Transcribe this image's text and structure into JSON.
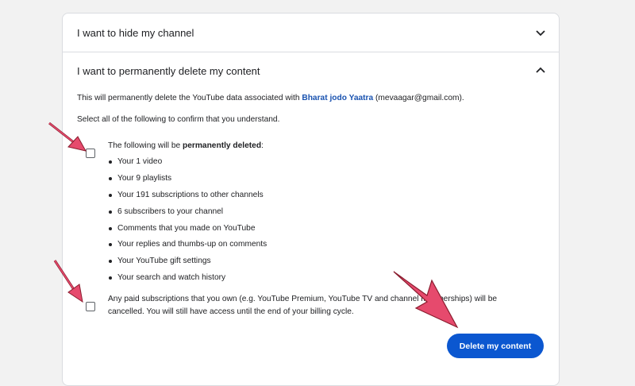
{
  "sections": [
    {
      "title": "I want to hide my channel",
      "state": "collapsed",
      "icon": "chevron-down-icon"
    },
    {
      "title": "I want to permanently delete my content",
      "state": "expanded",
      "icon": "chevron-up-icon"
    }
  ],
  "delete_section": {
    "info_prefix": "This will permanently delete the YouTube data associated with ",
    "channel_name": "Bharat jodo Yaatra",
    "info_suffix": " (mevaagar@gmail.com).",
    "confirm_instruction": "Select all of the following to confirm that you understand.",
    "checkbox1": {
      "checked": false,
      "label_prefix": "The following will be ",
      "label_bold": "permanently deleted",
      "label_suffix": ":"
    },
    "deleted_items": [
      "Your 1 video",
      "Your 9 playlists",
      "Your 191 subscriptions to other channels",
      "6 subscribers to your channel",
      "Comments that you made on YouTube",
      "Your replies and thumbs-up on comments",
      "Your YouTube gift settings",
      "Your search and watch history"
    ],
    "checkbox2": {
      "checked": false,
      "label": "Any paid subscriptions that you own (e.g. YouTube Premium, YouTube TV and channel memberships) will be cancelled. You will still have access until the end of your billing cycle."
    },
    "delete_button_label": "Delete my content"
  },
  "colors": {
    "accent": "#0b57d0",
    "link": "#1a53b0",
    "annotation_arrow": "#e64a6d"
  }
}
